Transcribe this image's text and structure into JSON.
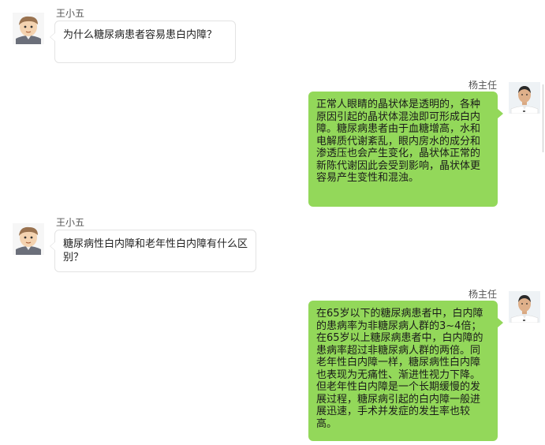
{
  "messages": [
    {
      "sender": "王小五",
      "side": "left",
      "text": "为什么糖尿病患者容易患白内障？"
    },
    {
      "sender": "杨主任",
      "side": "right",
      "text": "正常人眼睛的晶状体是透明的，各种原因引起的晶状体混浊即可形成白内障。糖尿病患者由于血糖增高，水和电解质代谢紊乱，眼内房水的成分和渗透压也会产生变化，晶状体正常的新陈代谢因此会受到影响，晶状体更容易产生变性和混浊。"
    },
    {
      "sender": "王小五",
      "side": "left",
      "text": "糖尿病性白内障和老年性白内障有什么区别？"
    },
    {
      "sender": "杨主任",
      "side": "right",
      "text": "在65岁以下的糖尿病患者中，白内障的患病率为非糖尿病人群的3~4倍；在65岁以上糖尿病患者中，白内障的患病率超过非糖尿病人群的两倍。同老年性白内障一样，糖尿病性白内障也表现为无痛性、渐进性视力下降。但老年性白内障是一个长期缓慢的发展过程，糖尿病引起的白内障一般进展迅速，手术并发症的发生率也较高。"
    }
  ],
  "colors": {
    "doctor_bubble": "#93d85a",
    "patient_bubble": "#ffffff",
    "patient_bubble_border": "#e3e3e3"
  },
  "icons": {
    "patient_avatar": "cartoon-boy-avatar",
    "doctor_avatar": "doctor-photo-avatar"
  }
}
